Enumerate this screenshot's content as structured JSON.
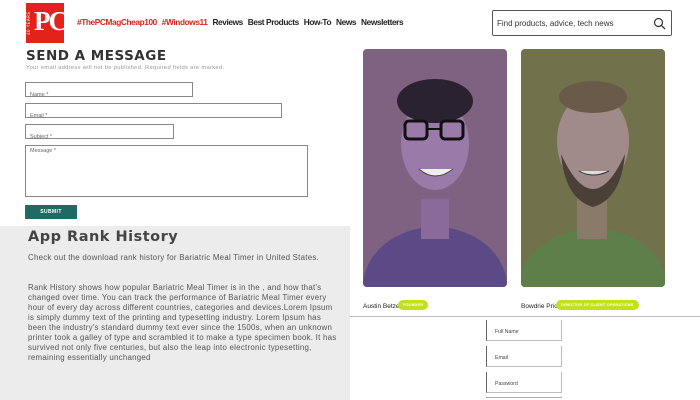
{
  "header": {
    "logo_text": "PC",
    "logo_years": "40 YEARS",
    "nav": [
      {
        "label": "#ThePCMagCheap100",
        "style": "hot"
      },
      {
        "label": "#Windows11",
        "style": "hot"
      },
      {
        "label": "Reviews",
        "style": "plain"
      },
      {
        "label": "Best Products",
        "style": "plain"
      },
      {
        "label": "How-To",
        "style": "plain"
      },
      {
        "label": "News",
        "style": "plain"
      },
      {
        "label": "Newsletters",
        "style": "plain"
      }
    ],
    "search_placeholder": "Find products, advice, tech news",
    "search_icon": "search-icon"
  },
  "contact_form": {
    "title": "SEND A MESSAGE",
    "note": "Your email address will not be published. Required fields are marked.",
    "name_placeholder": "Name *",
    "email_placeholder": "Email *",
    "subject_placeholder": "Subject *",
    "message_placeholder": "Message *",
    "submit_label": "SUBMIT"
  },
  "app_rank": {
    "title": "App Rank History",
    "paragraph_1": "Check out the download rank history for Bariatric Meal Timer in United States.",
    "paragraph_2": "Rank History shows how popular Bariatric Meal Timer is in the , and how that's changed over time. You can track the performance of Bariatric Meal Timer every hour of every day across different countries, categories and devices.Lorem Ipsum is simply dummy text of the printing and typesetting industry. Lorem Ipsum has been the industry's standard dummy text ever since the 1500s, when an unknown printer took a galley of type and scrambled it to make a type specimen book. It has survived not only five centuries, but also the leap into electronic typesetting, remaining essentially unchanged"
  },
  "team": [
    {
      "name": "Austin Betzer",
      "role": "FOUNDER"
    },
    {
      "name": "Bowdrie Price",
      "role": "DIRECTOR OF CLIENT OPERATIONS"
    }
  ],
  "signup_form": {
    "full_name_placeholder": "Full Name",
    "email_placeholder": "Email",
    "password_placeholder": "Password"
  },
  "colors": {
    "brand_red": "#e3231b",
    "submit_teal": "#1f6b63",
    "role_badge": "#c3e11a",
    "photo_tint": "#8f6fc9"
  }
}
